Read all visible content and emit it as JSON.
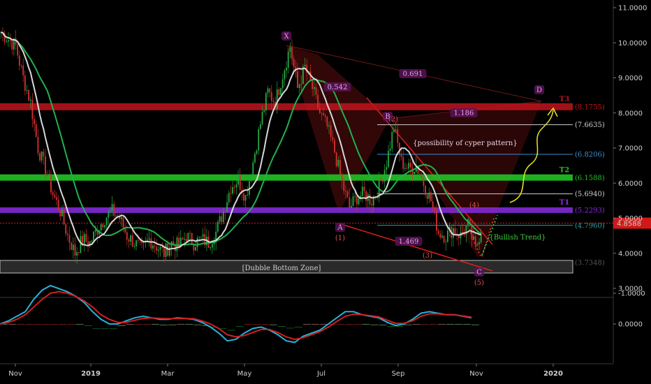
{
  "chart_data": [
    {
      "type": "candlestick",
      "ylim": [
        3.0,
        11.0
      ],
      "y_scale": "linear",
      "y_ticks": [
        "3.0000",
        "4.0000",
        "5.0000",
        "6.0000",
        "7.0000",
        "8.0000",
        "9.0000",
        "10.0000",
        "11.0000"
      ],
      "x_ticks": [
        "Nov",
        "2019",
        "Mar",
        "May",
        "Jul",
        "Sep",
        "Nov",
        "2020"
      ],
      "current_price": "4.8588",
      "price_path": [
        [
          "Oct 2018",
          10.3
        ],
        [
          "Oct 2018",
          10.1
        ],
        [
          "Oct 2018",
          9.9
        ],
        [
          "Nov 2018",
          9.0
        ],
        [
          "Nov 2018",
          8.3
        ],
        [
          "Nov 2018",
          7.0
        ],
        [
          "Nov 2018",
          6.4
        ],
        [
          "Nov 2018",
          5.7
        ],
        [
          "Nov 2018",
          5.2
        ],
        [
          "Dec 2018",
          4.5
        ],
        [
          "Dec 2018",
          4.0
        ],
        [
          "Dec 2018",
          4.4
        ],
        [
          "Dec 2018",
          4.3
        ],
        [
          "Dec 2018",
          4.7
        ],
        [
          "Jan 2019",
          5.0
        ],
        [
          "Jan 2019",
          5.2
        ],
        [
          "Jan 2019",
          5.0
        ],
        [
          "Jan 2019",
          4.5
        ],
        [
          "Jan 2019",
          4.3
        ],
        [
          "Feb 2019",
          4.1
        ],
        [
          "Feb 2019",
          4.4
        ],
        [
          "Feb 2019",
          4.2
        ],
        [
          "Feb 2019",
          4.0
        ],
        [
          "Mar 2019",
          4.3
        ],
        [
          "Mar 2019",
          4.2
        ],
        [
          "Mar 2019",
          4.5
        ],
        [
          "Mar 2019",
          4.3
        ],
        [
          "Apr 2019",
          4.4
        ],
        [
          "Apr 2019",
          4.3
        ],
        [
          "Apr 2019",
          4.6
        ],
        [
          "Apr 2019",
          5.2
        ],
        [
          "Apr 2019",
          5.9
        ],
        [
          "May 2019",
          6.1
        ],
        [
          "May 2019",
          5.6
        ],
        [
          "May 2019",
          6.6
        ],
        [
          "May 2019",
          7.7
        ],
        [
          "May 2019",
          8.6
        ],
        [
          "Jun 2019",
          8.3
        ],
        [
          "Jun 2019",
          9.1
        ],
        [
          "Jun 2019",
          9.9
        ],
        [
          "Jun 2019",
          8.7
        ],
        [
          "Jun 2019",
          9.3
        ],
        [
          "Jul 2019",
          8.7
        ],
        [
          "Jul 2019",
          8.0
        ],
        [
          "Jul 2019",
          7.6
        ],
        [
          "Jul 2019",
          6.9
        ],
        [
          "Jul 2019",
          6.0
        ],
        [
          "Jul 2019",
          5.3
        ],
        [
          "Aug 2019",
          5.6
        ],
        [
          "Aug 2019",
          5.7
        ],
        [
          "Aug 2019",
          5.5
        ],
        [
          "Aug 2019",
          5.9
        ],
        [
          "Aug 2019",
          6.6
        ],
        [
          "Aug 2019",
          7.6
        ],
        [
          "Sep 2019",
          6.6
        ],
        [
          "Sep 2019",
          6.4
        ],
        [
          "Sep 2019",
          6.5
        ],
        [
          "Sep 2019",
          6.0
        ],
        [
          "Sep 2019",
          5.5
        ],
        [
          "Sep 2019",
          4.6
        ],
        [
          "Oct 2019",
          4.5
        ],
        [
          "Oct 2019",
          4.7
        ],
        [
          "Oct 2019",
          4.5
        ],
        [
          "Oct 2019",
          4.8
        ],
        [
          "Oct 2019",
          4.1
        ],
        [
          "Oct 2019",
          4.9
        ]
      ],
      "moving_averages": [
        {
          "color": "#d8d8d8",
          "note": "short moving average"
        },
        {
          "color": "#22b14c",
          "note": "long moving average"
        }
      ],
      "horizontal_levels": [
        {
          "label": "T3",
          "value": "(8.1755)",
          "y": 8.1755,
          "color": "#c0141c"
        },
        {
          "label": "",
          "value": "(7.6635)",
          "y": 7.6635,
          "color": "#cfcfcf"
        },
        {
          "label": "",
          "value": "(6.8206)",
          "y": 6.8206,
          "color": "#3a8fd0"
        },
        {
          "label": "T2",
          "value": "(6.1588)",
          "y": 6.1588,
          "color": "#22c322"
        },
        {
          "label": "",
          "value": "(5.6940)",
          "y": 5.694,
          "color": "#cfcfcf"
        },
        {
          "label": "T1",
          "value": "(5.2293)",
          "y": 5.2293,
          "color": "#8a2be2"
        },
        {
          "label": "",
          "value": "(4.7960)",
          "y": 4.796,
          "color": "#3a9e9e"
        },
        {
          "label": "",
          "value": "(3.7348)",
          "y": 3.7348,
          "color": "#666666"
        }
      ],
      "annotations": {
        "pattern_points": [
          "X",
          "A",
          "B",
          "C",
          "D"
        ],
        "wave_labels": [
          "(1)",
          "(2)",
          "(3)",
          "(4)",
          "(5)"
        ],
        "ratios": [
          "0.542",
          "0.691",
          "1.186",
          "1.469"
        ],
        "texts": [
          "{possibility of cyper pattern}",
          "{Bullish Trend}",
          "[Dubble Bottom Zone]"
        ]
      }
    },
    {
      "type": "macd",
      "ylim": [
        -1.3,
        0.6
      ],
      "y_ticks": [
        "0.0000",
        "-1.0000"
      ],
      "macd_line": [
        0.0,
        -0.1,
        -0.25,
        -0.4,
        -0.8,
        -1.1,
        -1.25,
        -1.15,
        -1.05,
        -0.9,
        -0.7,
        -0.4,
        -0.15,
        0.0,
        0.0,
        -0.1,
        -0.2,
        -0.25,
        -0.2,
        -0.15,
        -0.15,
        -0.2,
        -0.18,
        -0.15,
        -0.05,
        0.1,
        0.3,
        0.55,
        0.5,
        0.3,
        0.15,
        0.1,
        0.2,
        0.35,
        0.55,
        0.6,
        0.4,
        0.3,
        0.2,
        0.0,
        -0.2,
        -0.4,
        -0.4,
        -0.3,
        -0.25,
        -0.2,
        -0.05,
        0.05,
        0.0,
        -0.15,
        -0.35,
        -0.4,
        -0.35,
        -0.3,
        -0.3,
        -0.25,
        -0.2
      ],
      "signal_line": [
        0.0,
        -0.05,
        -0.15,
        -0.3,
        -0.55,
        -0.8,
        -1.0,
        -1.05,
        -1.0,
        -0.9,
        -0.75,
        -0.55,
        -0.3,
        -0.15,
        -0.05,
        -0.05,
        -0.12,
        -0.18,
        -0.2,
        -0.18,
        -0.17,
        -0.18,
        -0.18,
        -0.17,
        -0.1,
        0.0,
        0.15,
        0.35,
        0.42,
        0.38,
        0.28,
        0.18,
        0.18,
        0.28,
        0.42,
        0.5,
        0.45,
        0.35,
        0.25,
        0.1,
        -0.08,
        -0.25,
        -0.32,
        -0.3,
        -0.27,
        -0.23,
        -0.12,
        -0.02,
        -0.02,
        -0.1,
        -0.25,
        -0.33,
        -0.33,
        -0.3,
        -0.3,
        -0.26,
        -0.22
      ]
    }
  ]
}
